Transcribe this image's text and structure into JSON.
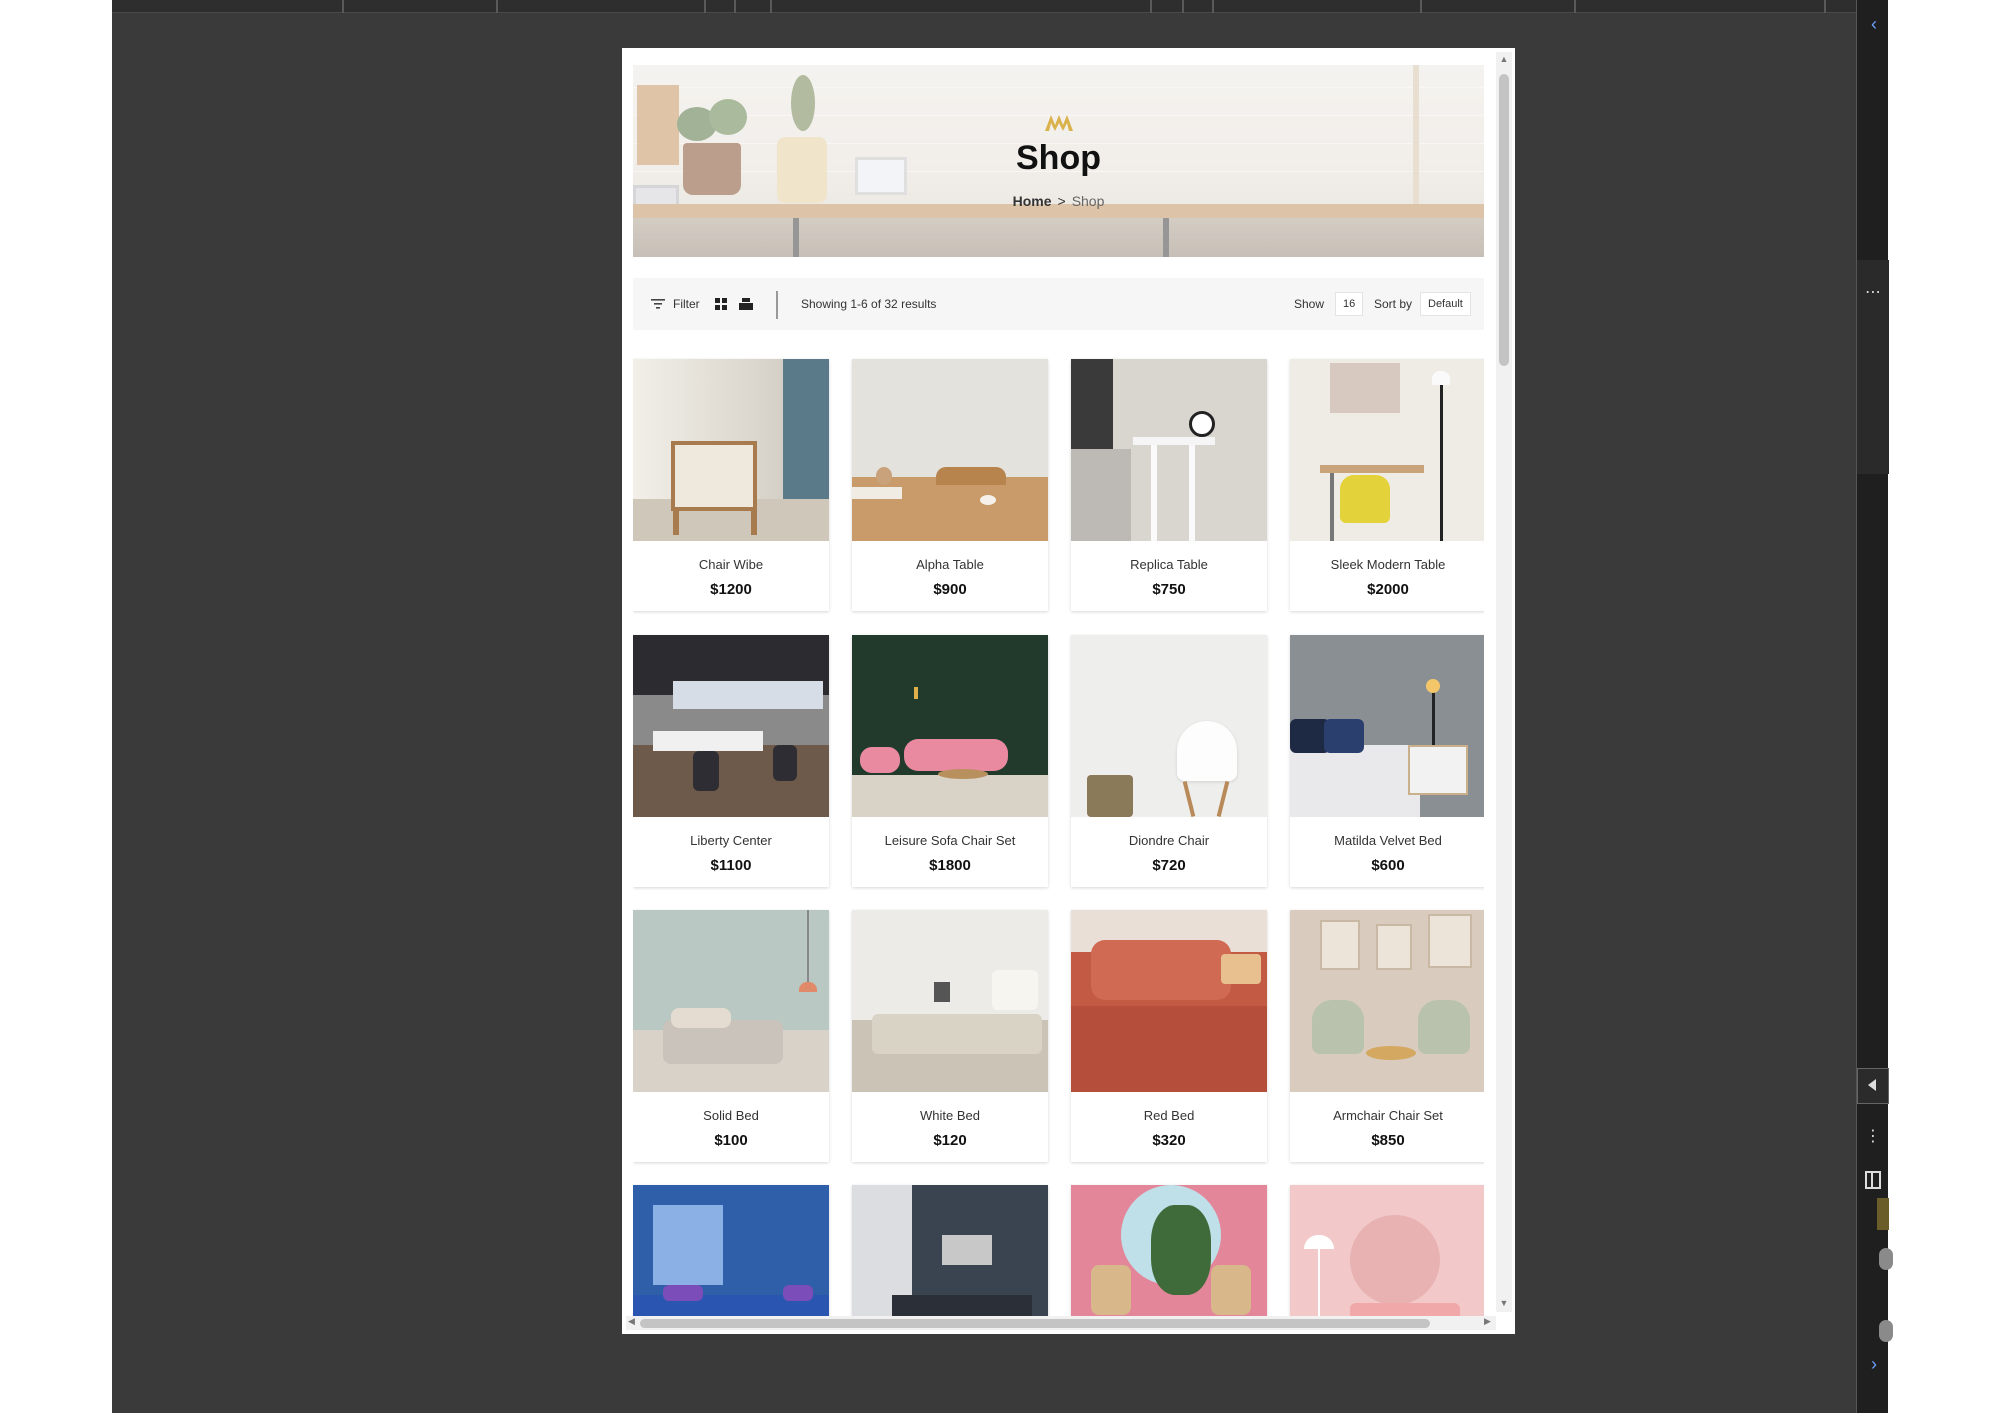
{
  "hero": {
    "title": "Shop",
    "breadcrumb": {
      "home": "Home",
      "separator": ">",
      "current": "Shop"
    }
  },
  "toolbar": {
    "filter_label": "Filter",
    "results_text": "Showing 1-6 of 32 results",
    "show_label": "Show",
    "show_value": "16",
    "sort_label": "Sort by",
    "sort_value": "Default"
  },
  "products": [
    {
      "name": "Chair Wibe",
      "price": "$1200"
    },
    {
      "name": "Alpha Table",
      "price": "$900"
    },
    {
      "name": "Replica Table",
      "price": "$750"
    },
    {
      "name": "Sleek Modern Table",
      "price": "$2000"
    },
    {
      "name": "Liberty Center",
      "price": "$1100"
    },
    {
      "name": "Leisure Sofa Chair Set",
      "price": "$1800"
    },
    {
      "name": "Diondre Chair",
      "price": "$720"
    },
    {
      "name": "Matilda Velvet Bed",
      "price": "$600"
    },
    {
      "name": "Solid Bed",
      "price": "$100"
    },
    {
      "name": "White Bed",
      "price": "$120"
    },
    {
      "name": "Red Bed",
      "price": "$320"
    },
    {
      "name": "Armchair Chair Set",
      "price": "$850"
    }
  ],
  "colors": {
    "editor_background": "#3a3a3a",
    "logo_gold": "#d9b24c",
    "toolbar_background": "#f6f6f6"
  }
}
